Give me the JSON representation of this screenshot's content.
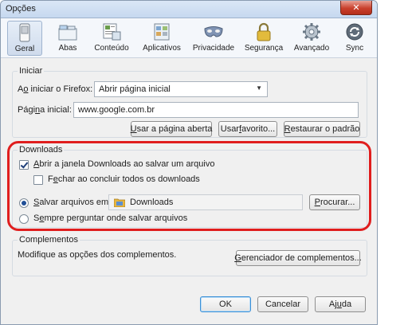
{
  "window": {
    "title": "Opções",
    "close_symbol": "✕"
  },
  "toolbar": {
    "items": [
      {
        "label": "Geral",
        "icon": "switch-icon"
      },
      {
        "label": "Abas",
        "icon": "tabs-icon"
      },
      {
        "label": "Conteúdo",
        "icon": "content-icon"
      },
      {
        "label": "Aplicativos",
        "icon": "applications-icon"
      },
      {
        "label": "Privacidade",
        "icon": "mask-icon"
      },
      {
        "label": "Segurança",
        "icon": "lock-icon"
      },
      {
        "label": "Avançado",
        "icon": "gear-icon"
      },
      {
        "label": "Sync",
        "icon": "sync-icon"
      }
    ],
    "active": "Geral"
  },
  "startup": {
    "title": "Iniciar",
    "start_label_prefix": "A",
    "start_label_underline": "o",
    "start_label_rest": " iniciar o Firefox:",
    "start_value": "Abrir página inicial",
    "home_label_prefix": "Pági",
    "home_label_underline": "n",
    "home_label_rest": "a inicial:",
    "home_value": "www.google.com.br",
    "btn_current_u": "U",
    "btn_current_rest": "sar a página aberta",
    "btn_bookmark_prefix": "Usar ",
    "btn_bookmark_u": "f",
    "btn_bookmark_rest": "avorito...",
    "btn_restore_u": "R",
    "btn_restore_rest": "estaurar o padrão"
  },
  "downloads": {
    "title": "Downloads",
    "show_window_u": "A",
    "show_window_rest": "brir a janela Downloads ao salvar um arquivo",
    "show_window_checked": true,
    "close_when_done_prefix": "F",
    "close_when_done_u": "e",
    "close_when_done_rest": "char ao concluir todos os downloads",
    "close_when_done_checked": false,
    "save_to_u": "S",
    "save_to_rest": "alvar arquivos em:",
    "save_to_selected": true,
    "folder": "Downloads",
    "browse_u": "P",
    "browse_rest": "rocurar...",
    "always_ask_prefix": "S",
    "always_ask_u": "e",
    "always_ask_rest": "mpre perguntar onde salvar arquivos",
    "always_ask_selected": false
  },
  "addons": {
    "title": "Complementos",
    "description": "Modifique as opções dos complementos.",
    "manage_u": "G",
    "manage_rest": "erenciador de complementos..."
  },
  "footer": {
    "ok": "OK",
    "cancel": "Cancelar",
    "help_prefix": "Aj",
    "help_u": "u",
    "help_rest": "da"
  },
  "colors": {
    "highlight": "#e01e1e",
    "close_button": "#c9402c"
  }
}
